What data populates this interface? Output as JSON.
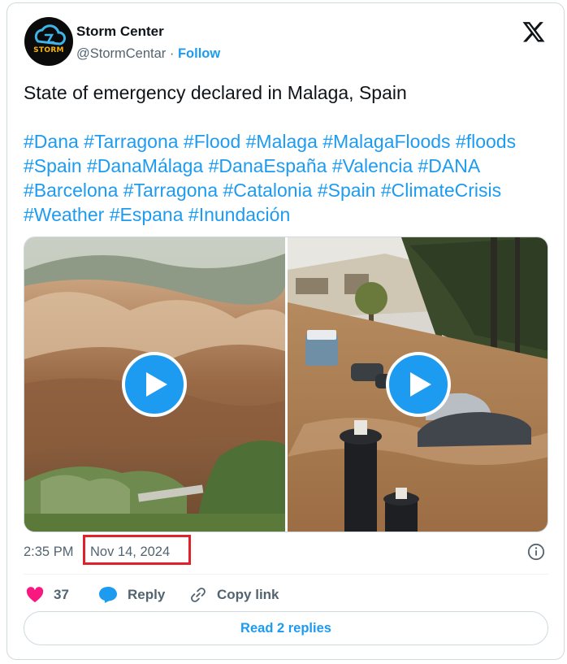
{
  "author": {
    "avatar_text": "STORM",
    "display_name": "Storm Center",
    "handle": "@StormCentar",
    "separator": "·",
    "follow_label": "Follow"
  },
  "tweet": {
    "text": "State of emergency declared in Malaga, Spain",
    "hashtags": [
      "#Dana",
      "#Tarragona",
      "#Flood",
      "#Malaga",
      "#MalagaFloods",
      "#floods",
      "#Spain",
      "#DanaMálaga",
      "#DanaEspaña",
      "#Valencia",
      "#DANA",
      "#Barcelona",
      "#Tarragona",
      "#Catalonia",
      "#Spain",
      "#ClimateCrisis",
      "#Weather",
      "#Espana",
      "#Inundación"
    ]
  },
  "media": {
    "videos": [
      {
        "icon": "play-icon"
      },
      {
        "icon": "play-icon"
      }
    ]
  },
  "meta": {
    "time": "2:35 PM",
    "date": "Nov 14, 2024"
  },
  "actions": {
    "like_count": "37",
    "reply_label": "Reply",
    "copy_label": "Copy link"
  },
  "read_replies_label": "Read 2 replies",
  "colors": {
    "accent": "#1d9bf0",
    "text": "#0f1419",
    "secondary": "#536471",
    "like": "#f91880",
    "highlight_box": "#e0202a"
  }
}
